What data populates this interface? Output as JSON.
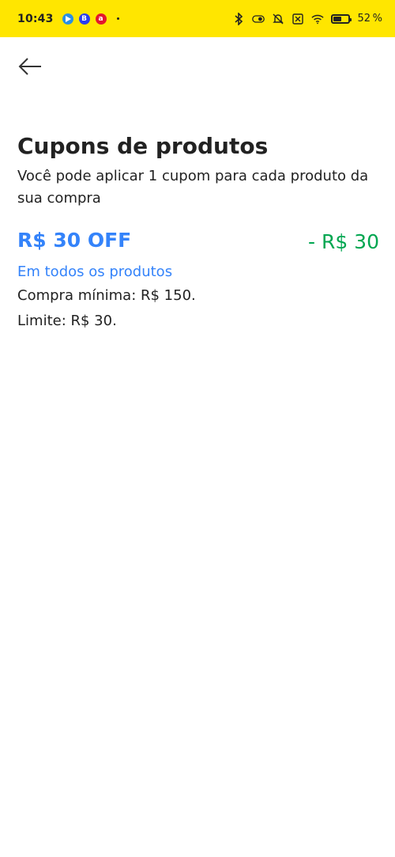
{
  "status_bar": {
    "time": "10:43",
    "battery_percent": "52",
    "battery_level": 0.52,
    "battery_suffix": "%",
    "notification_icons": [
      "play-store-icon",
      "b-app-icon",
      "a-app-icon"
    ],
    "system_icons": [
      "bluetooth-icon",
      "nfc-toggle-icon",
      "do-not-disturb-off-icon",
      "no-sim-icon",
      "wifi-icon",
      "battery-icon"
    ]
  },
  "header": {
    "back_icon": "arrow-left-icon"
  },
  "page": {
    "title": "Cupons de produtos",
    "subtitle": "Você pode aplicar 1 cupom para cada produto da sua compra"
  },
  "coupon": {
    "title": "R$ 30 OFF",
    "discount": "- R$ 30",
    "scope": "Em todos os produtos",
    "min_purchase": "Compra mínima: R$ 150.",
    "limit": "Limite: R$ 30."
  },
  "colors": {
    "status_bar_bg": "#ffe600",
    "accent_blue": "#3483fa",
    "discount_green": "#00a650",
    "text": "#222222"
  }
}
